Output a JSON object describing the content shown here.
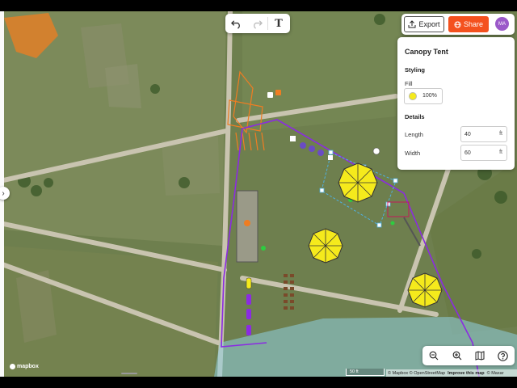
{
  "toolbar": {
    "undo_icon": "undo-icon",
    "redo_icon": "redo-icon",
    "text_tool_label": "T"
  },
  "header": {
    "export_label": "Export",
    "share_label": "Share",
    "avatar_initials": "MA"
  },
  "panel": {
    "title": "Canopy Tent",
    "styling_heading": "Styling",
    "fill_label": "Fill",
    "fill_color": "#f5ea1c",
    "fill_opacity": "100%",
    "details_heading": "Details",
    "length_label": "Length",
    "length_value": "40",
    "length_unit": "ft",
    "width_label": "Width",
    "width_value": "60",
    "width_unit": "ft"
  },
  "map_controls": {
    "zoom_out_icon": "zoom-out-icon",
    "zoom_in_icon": "zoom-in-icon",
    "map_style_icon": "map-icon",
    "help_icon": "help-icon"
  },
  "map": {
    "scale_label": "50 ft",
    "logo_text": "mapbox",
    "attribution": {
      "copyright": "© Mapbox © OpenStreetMap",
      "improve": "Improve this map",
      "maxar": "© Maxar"
    }
  },
  "colors": {
    "boundary": "#8b2be2",
    "tent": "#f5ea1c",
    "share_button": "#f4511e",
    "avatar": "#9b59c9",
    "orange_area": "#ef7d22",
    "water_area": "#8fd0e0"
  }
}
